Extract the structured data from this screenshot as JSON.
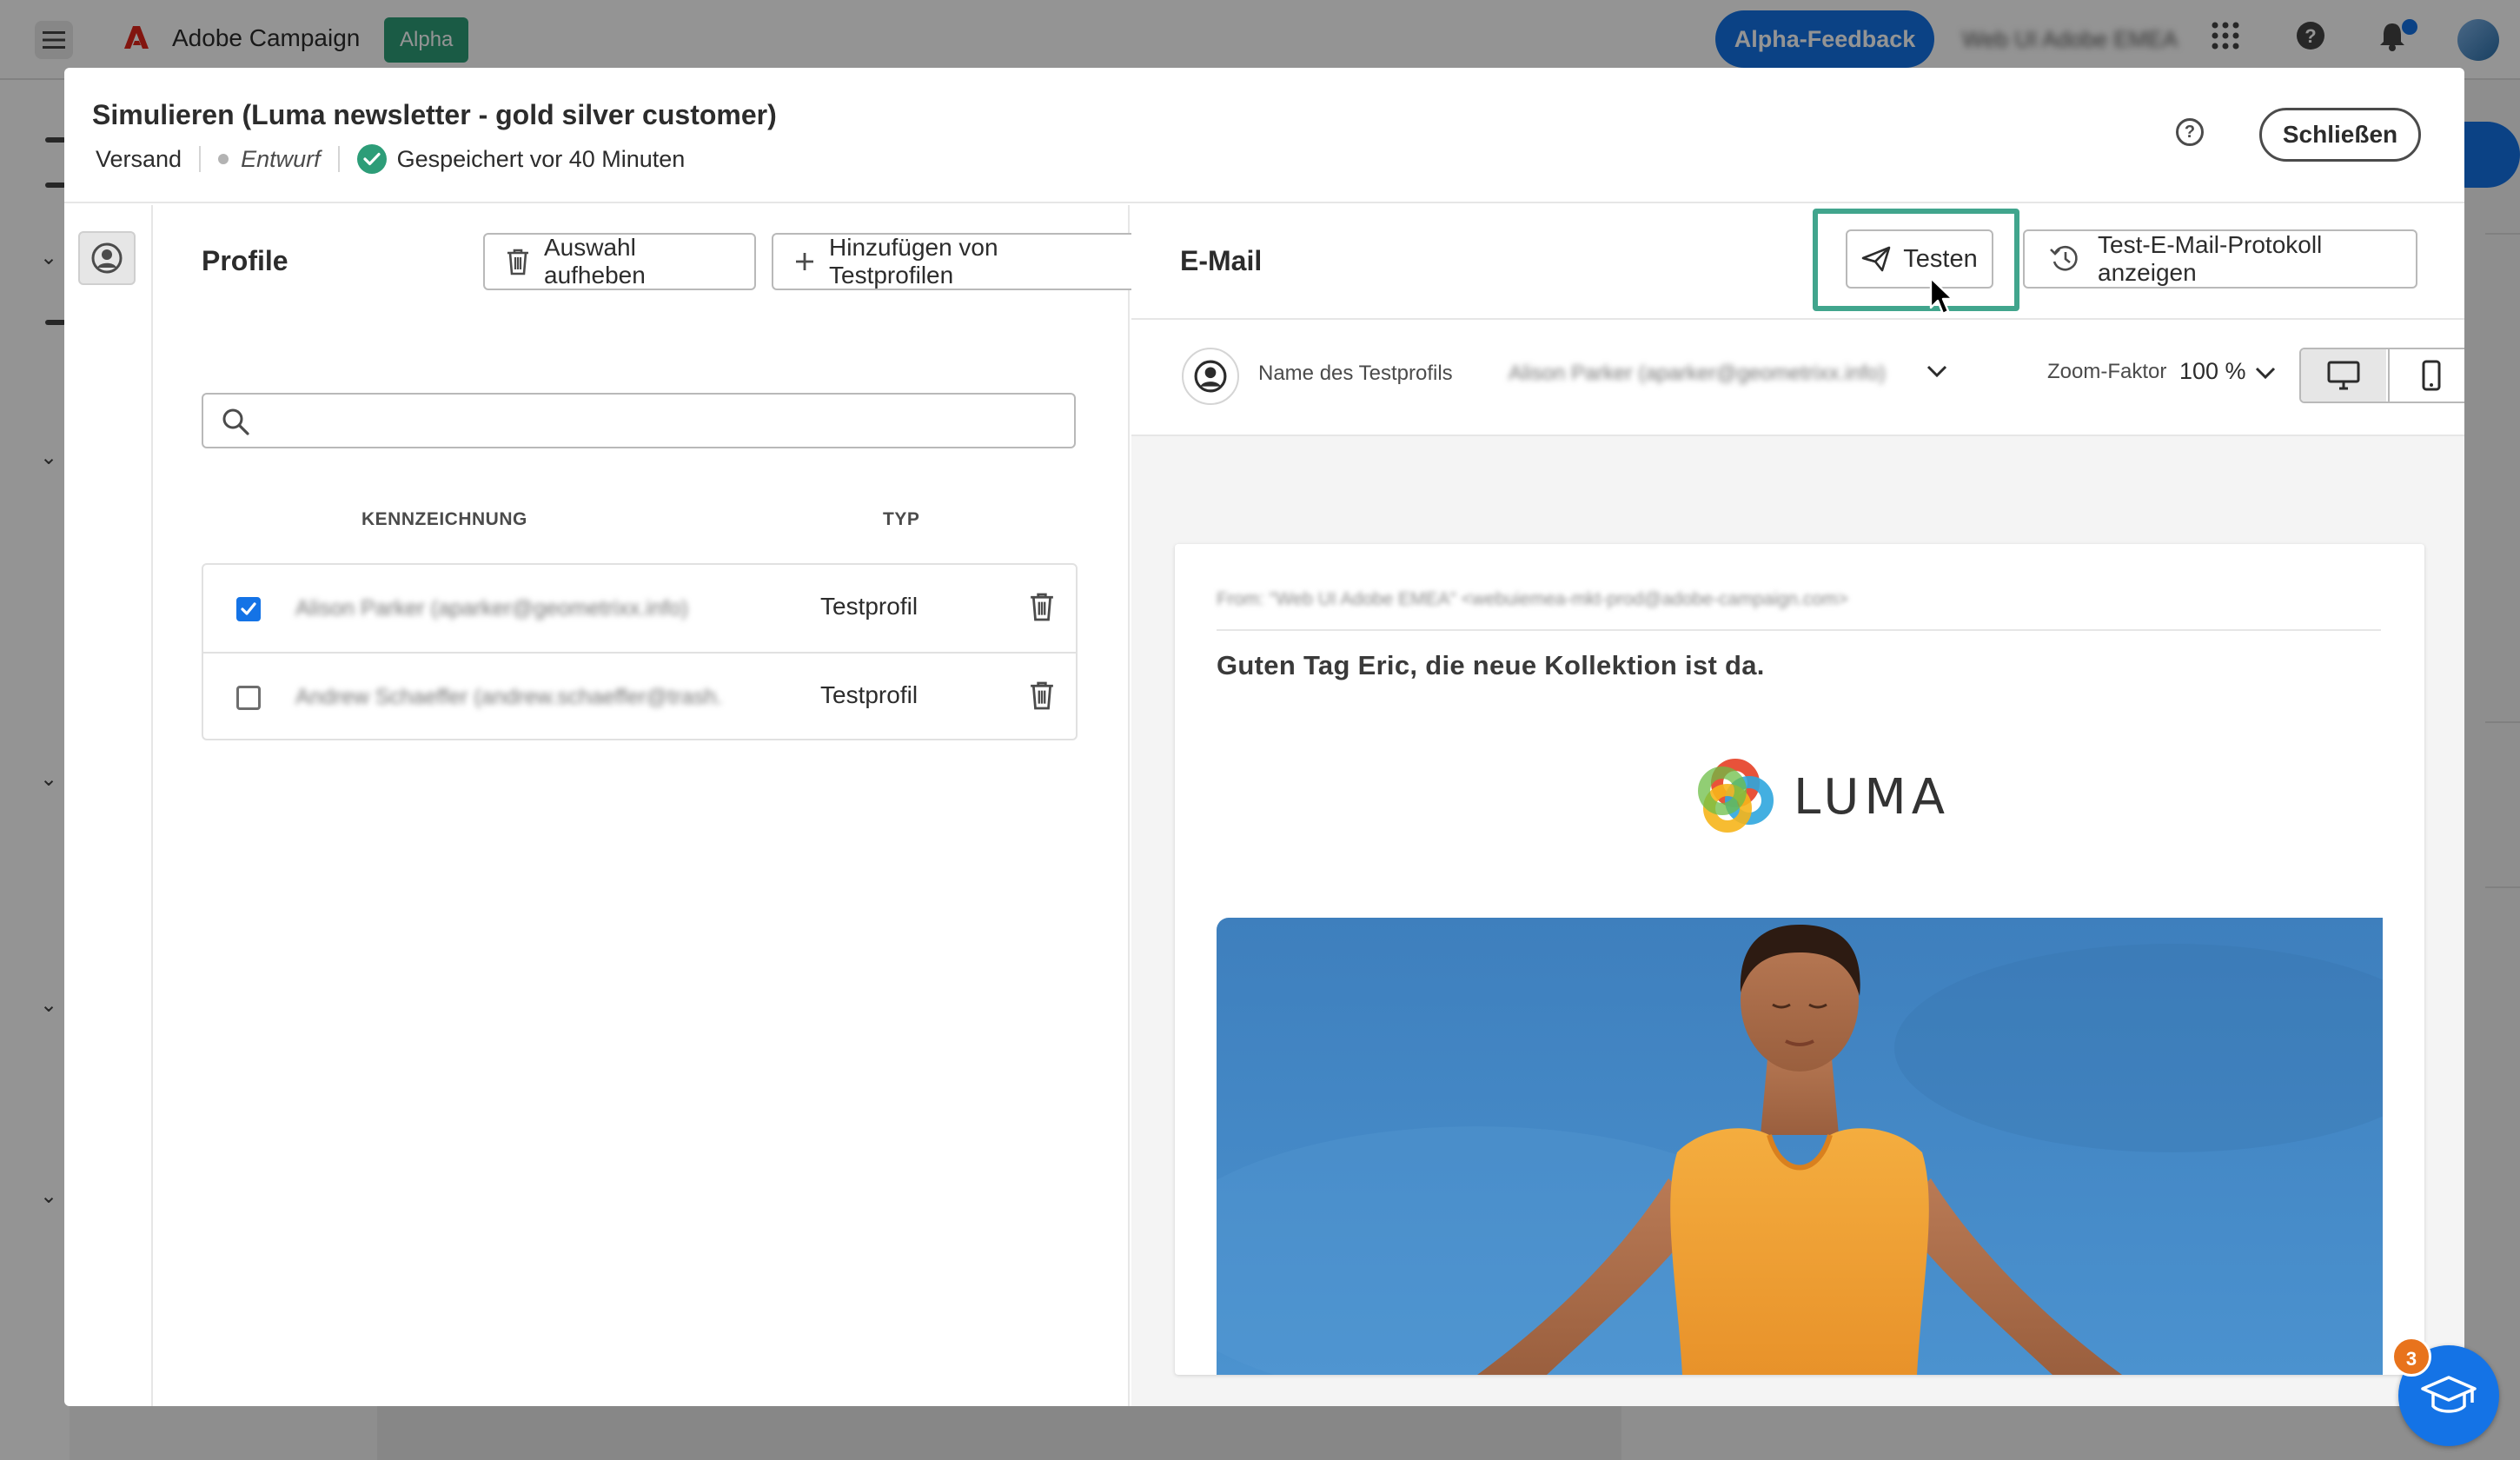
{
  "app": {
    "name": "Adobe Campaign",
    "badge": "Alpha",
    "feedback_label": "Alpha-Feedback",
    "org_name": "Web UI Adobe EMEA",
    "menu_icon": "hamburger-icon",
    "apps_icon": "apps-grid-icon",
    "help_icon": "help-icon",
    "bell_icon": "bell-icon"
  },
  "dialog": {
    "title": "Simulieren (Luma newsletter - gold silver customer)",
    "type": "Versand",
    "status": "Entwurf",
    "saved": "Gespeichert vor 40 Minuten",
    "help_label": "?",
    "close_label": "Schließen"
  },
  "profiles": {
    "title": "Profile",
    "clear_label": "Auswahl aufheben",
    "add_label": "Hinzufügen von Testprofilen",
    "search_placeholder": "",
    "columns": {
      "label": "KENNZEICHNUNG",
      "type": "TYP"
    },
    "rows": [
      {
        "label": "Alison Parker (aparker@geometrixx.info)",
        "type": "Testprofil",
        "checked": true
      },
      {
        "label": "Andrew Schaeffer (andrew.schaeffer@trash...",
        "type": "Testprofil",
        "checked": false
      }
    ]
  },
  "email": {
    "title": "E-Mail",
    "test_label": "Testen",
    "log_label": "Test-E-Mail-Protokoll anzeigen",
    "test_profile_label": "Name des Testprofils",
    "test_profile_value": "Alison Parker (aparker@geometrixx.info)",
    "zoom_label": "Zoom-Faktor",
    "zoom_value": "100 %",
    "from": "From: \"Web UI Adobe EMEA\" <webuiemea-mkt-prod@adobe-campaign.com>",
    "subject": "Guten Tag Eric, die neue Kollektion ist da.",
    "brand": "LUMA"
  },
  "help_fab": {
    "badge": "3",
    "icon": "graduation-cap-icon"
  },
  "colors": {
    "accent_blue": "#1473e6",
    "alpha_green": "#2d9d78",
    "highlight_teal": "#41a58d",
    "badge_orange": "#e8731c",
    "hero_sky": "#3f86c3",
    "shirt_orange": "#f2a33a"
  }
}
